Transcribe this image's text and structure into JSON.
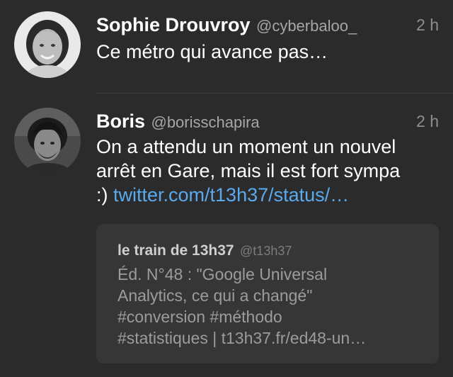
{
  "tweets": [
    {
      "name": "Sophie Drouvroy",
      "handle": "@cyberbaloo_",
      "time": "2 h",
      "text": "Ce métro qui avance pas…",
      "avatar_icon": "avatar-photo-woman"
    },
    {
      "name": "Boris",
      "handle": "@borisschapira",
      "time": "2 h",
      "text_lines": [
        "On a attendu un moment un nouvel",
        "arrêt en Gare, mais il est fort sympa",
        ":) "
      ],
      "link": "twitter.com/t13h37/status/…",
      "avatar_icon": "avatar-photo-man",
      "quote": {
        "name": "le train de 13h37",
        "handle": "@t13h37",
        "text_lines": [
          "Éd. N°48 : \"Google Universal",
          "Analytics, ce qui a changé\"",
          "#conversion #méthodo",
          "#statistiques | t13h37.fr/ed48-un…"
        ]
      }
    }
  ],
  "colors": {
    "background": "#2b2b2b",
    "name": "#ffffff",
    "handle": "#a6a6a6",
    "link": "#5aaaf0",
    "quote_background": "#363636"
  }
}
